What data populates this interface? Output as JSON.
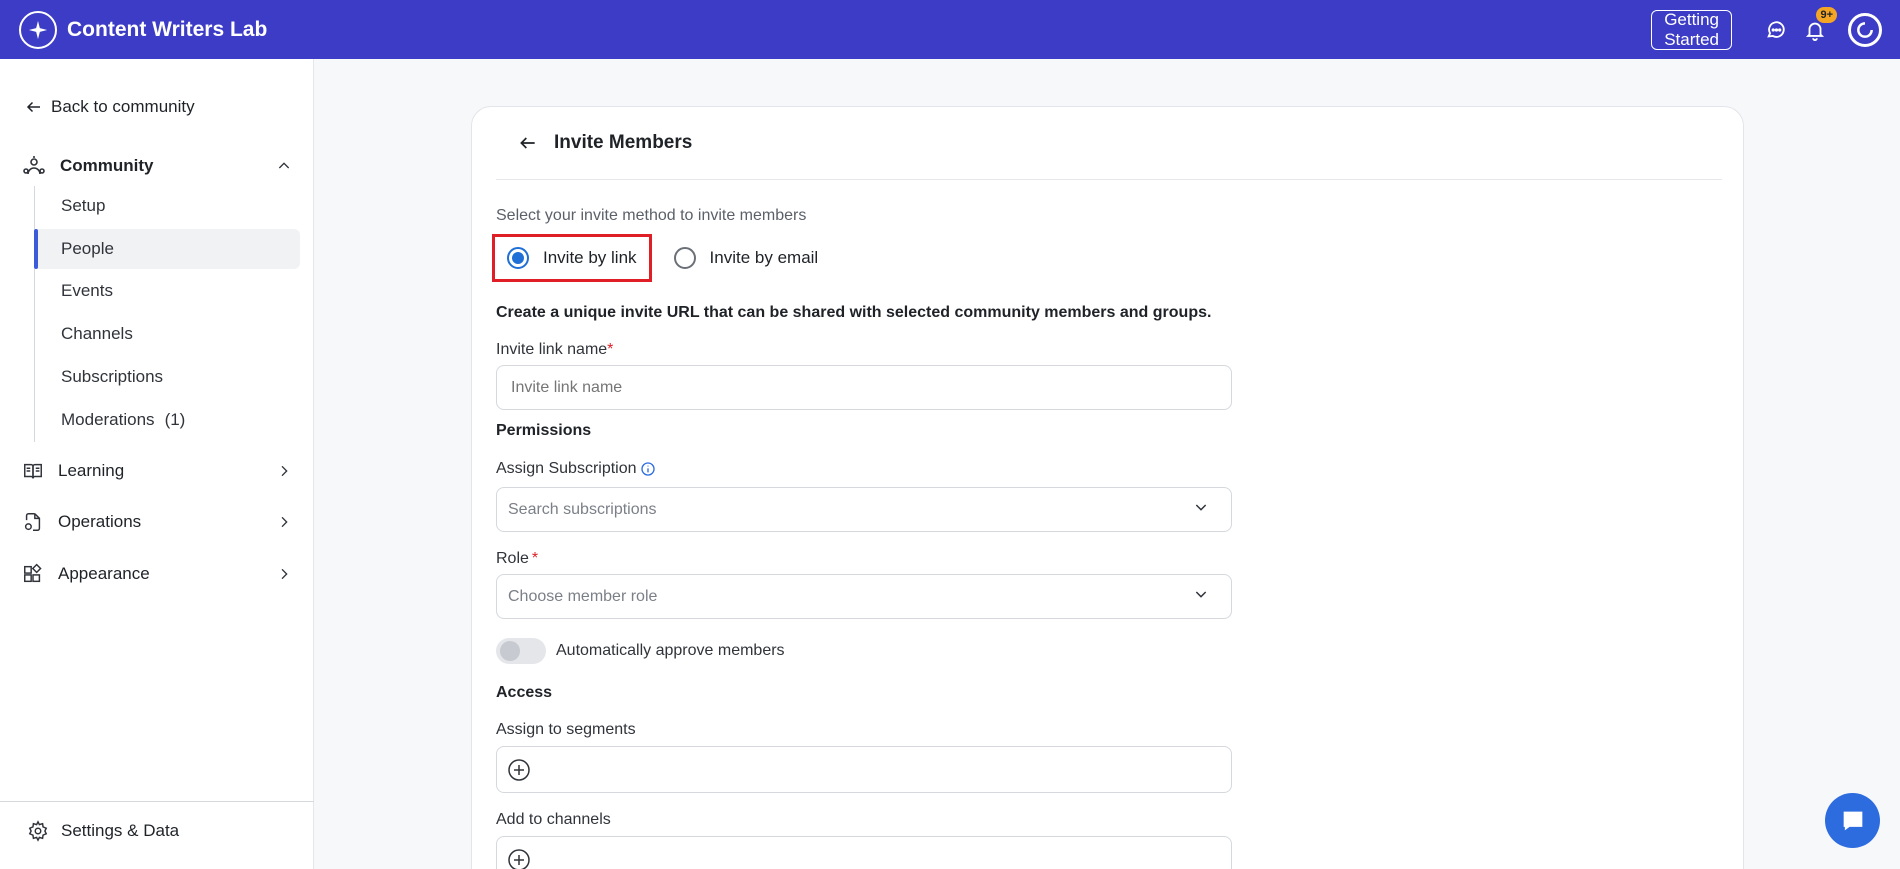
{
  "topbar": {
    "brand_name": "Content Writers Lab",
    "brand_icon": "sparkle-icon",
    "getting_started_label": "Getting Started",
    "notification_badge": "9+",
    "bg_color": "#3d3cc6"
  },
  "sidebar": {
    "back_label": "Back to community",
    "community": {
      "label": "Community",
      "items": [
        {
          "label": "Setup"
        },
        {
          "label": "People",
          "active": true
        },
        {
          "label": "Events"
        },
        {
          "label": "Channels"
        },
        {
          "label": "Subscriptions"
        },
        {
          "label": "Moderations",
          "count": "(1)"
        }
      ]
    },
    "learning_label": "Learning",
    "operations_label": "Operations",
    "appearance_label": "Appearance",
    "settings_label": "Settings & Data"
  },
  "main": {
    "title": "Invite Members",
    "method_label": "Select your invite method to invite members",
    "method_options": [
      {
        "label": "Invite by link",
        "selected": true
      },
      {
        "label": "Invite by email",
        "selected": false
      }
    ],
    "description": "Create a unique invite URL that can be shared with selected community members and groups.",
    "invite_link_name": {
      "label": "Invite link name",
      "required_mark": "*",
      "placeholder": "Invite link name",
      "value": ""
    },
    "permissions_title": "Permissions",
    "assign_subscription": {
      "label": "Assign Subscription",
      "placeholder": "Search subscriptions"
    },
    "role": {
      "label": "Role",
      "required_mark": "*",
      "placeholder": "Choose member role"
    },
    "auto_approve": {
      "label": "Automatically approve members",
      "enabled": false
    },
    "access_title": "Access",
    "assign_segments_label": "Assign to segments",
    "add_channels_label": "Add to channels"
  },
  "colors": {
    "accent": "#3b5bdb",
    "radio_selected": "#1f6fd6",
    "highlight": "#e01e26",
    "fab": "#2d6cdf"
  }
}
